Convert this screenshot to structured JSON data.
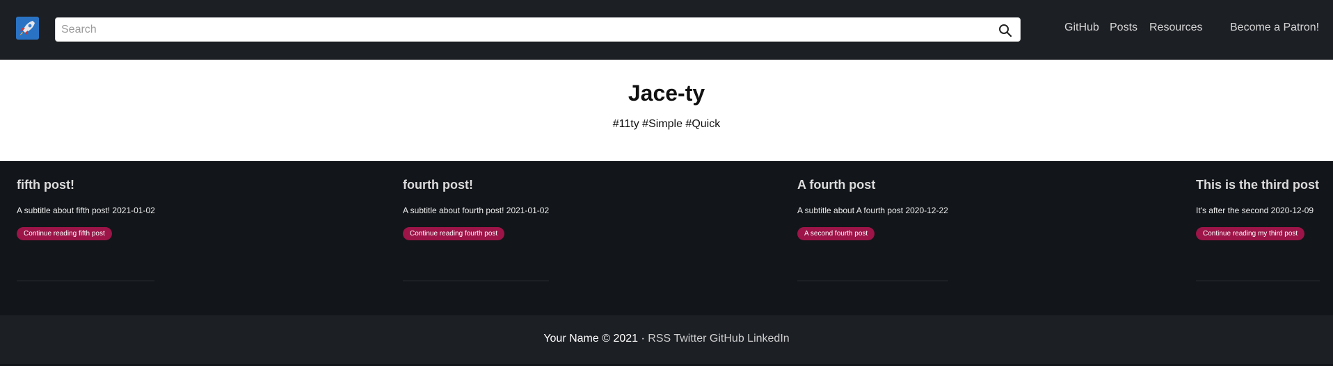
{
  "navbar": {
    "search_placeholder": "Search",
    "links": [
      "GitHub",
      "Posts",
      "Resources",
      "Become a Patron!"
    ]
  },
  "hero": {
    "title": "Jace-ty",
    "tags": "#11ty #Simple #Quick"
  },
  "posts": [
    {
      "title": "fifth post!",
      "subtitle": "A subtitle about fifth post! 2021-01-02",
      "button": "Continue reading fifth post"
    },
    {
      "title": "fourth post!",
      "subtitle": "A subtitle about fourth post! 2021-01-02",
      "button": "Continue reading fourth post"
    },
    {
      "title": "A fourth post",
      "subtitle": "A subtitle about A fourth post 2020-12-22",
      "button": "A second fourth post"
    },
    {
      "title": "This is the third post",
      "subtitle": "It's after the second 2020-12-09",
      "button": "Continue reading my third post"
    }
  ],
  "footer": {
    "copyright": "Your Name © 2021 ·",
    "links": [
      "RSS",
      "Twitter",
      "GitHub",
      "LinkedIn"
    ]
  },
  "colors": {
    "navbar_bg": "#1c1f24",
    "page_bg": "#121519",
    "button_accent": "#9c1448"
  },
  "icons": {
    "logo": "rocket-icon",
    "search": "search-icon"
  }
}
